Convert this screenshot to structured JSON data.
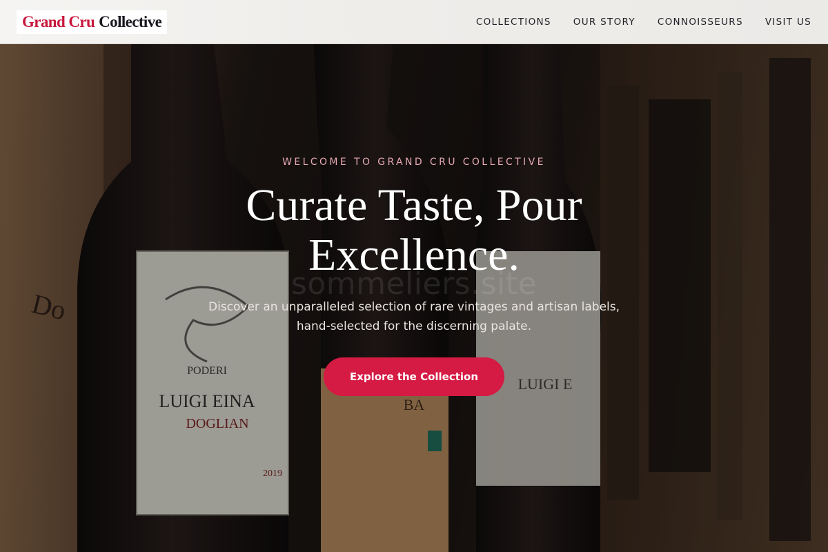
{
  "brand": {
    "name_accent": "Grand Cru",
    "name_main": "Collective",
    "accent_color": "#c8183d"
  },
  "nav": {
    "items": [
      {
        "label": "COLLECTIONS"
      },
      {
        "label": "OUR STORY"
      },
      {
        "label": "CONNOISSEURS"
      },
      {
        "label": "VISIT US"
      }
    ]
  },
  "hero": {
    "background": "wine bottles on a shelf",
    "eyebrow": "WELCOME TO GRAND CRU COLLECTIVE",
    "headline": "Curate Taste, Pour Excellence.",
    "watermark": "sommeliers.site",
    "subhead": "Discover an unparalleled selection of rare vintages and artisan labels, hand-selected for the discerning palate.",
    "cta_label": "Explore the Collection",
    "cta_color": "#d51a43"
  }
}
